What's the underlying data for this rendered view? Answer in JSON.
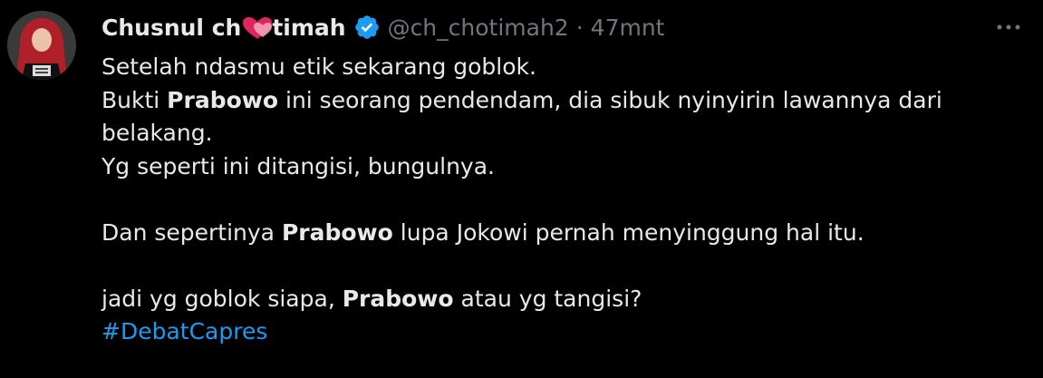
{
  "user": {
    "name_prefix": "Chusnul ch",
    "name_emoji": "heart-icon",
    "name_suffix": "timah",
    "handle": "@ch_chotimah2",
    "separator": "·",
    "time": "47mnt",
    "verified": true
  },
  "tweet": {
    "line1": "Setelah ndasmu etik sekarang goblok.",
    "line2_a": "Bukti ",
    "line2_b": "Prabowo",
    "line2_c": " ini seorang pendendam, dia sibuk nyinyirin lawannya dari",
    "line3": "belakang.",
    "line4": "Yg seperti ini ditangisi, bungulnya.",
    "line5_a": "Dan sepertinya ",
    "line5_b": "Prabowo",
    "line5_c": " lupa Jokowi pernah menyinggung hal itu.",
    "line6_a": "jadi yg goblok siapa, ",
    "line6_b": "Prabowo",
    "line6_c": " atau yg tangisi?",
    "hashtag": "#DebatCapres"
  },
  "colors": {
    "background": "#000000",
    "text": "#e7e9ea",
    "muted": "#71767b",
    "link": "#1d9bf0",
    "verified": "#1d9bf0"
  }
}
